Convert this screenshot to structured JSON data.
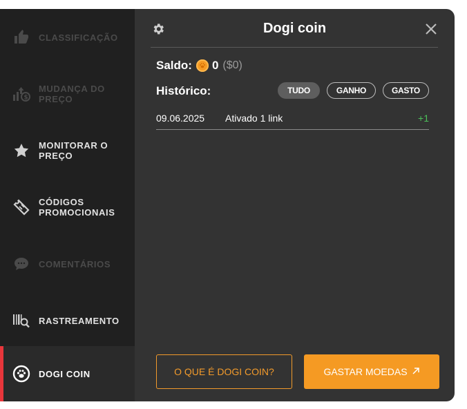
{
  "sidebar": {
    "items": [
      {
        "label": "CLASSIFICAÇÃO",
        "icon": "thumbs-up-icon",
        "state": "disabled"
      },
      {
        "label": "MUDANÇA DO PREÇO",
        "icon": "price-change-icon",
        "state": "disabled"
      },
      {
        "label": "MONITORAR O PREÇO",
        "icon": "star-icon",
        "state": "enabled"
      },
      {
        "label": "CÓDIGOS PROMOCIONAIS",
        "icon": "ticket-icon",
        "state": "enabled"
      },
      {
        "label": "COMENTÁRIOS",
        "icon": "comment-icon",
        "state": "disabled"
      },
      {
        "label": "RASTREAMENTO",
        "icon": "barcode-search-icon",
        "state": "enabled"
      },
      {
        "label": "DOGI COIN",
        "icon": "paw-icon",
        "state": "active"
      }
    ],
    "active_color": "#e8363b"
  },
  "panel": {
    "title": "Dogi coin",
    "saldo_label": "Saldo:",
    "balance": "0",
    "balance_usd": "($0)",
    "historico_label": "Histórico:",
    "filters": [
      {
        "label": "TUDO",
        "selected": true
      },
      {
        "label": "GANHO",
        "selected": false
      },
      {
        "label": "GASTO",
        "selected": false
      }
    ],
    "history": [
      {
        "date": "09.06.2025",
        "description": "Ativado 1 link",
        "delta": "+1"
      }
    ],
    "btn_what": "O QUE É DOGI COIN?",
    "btn_spend": "GASTAR MOEDAS",
    "btn_spend_icon": "external-arrow-icon",
    "accent": "#f59a23",
    "positive_color": "#4cc15a"
  }
}
